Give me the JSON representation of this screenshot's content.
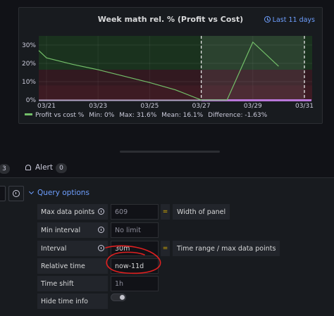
{
  "panel": {
    "title": "Week math rel. % (Profit vs Cost)",
    "time_range": "Last 11 days",
    "legend": {
      "series": "Profit vs cost %",
      "min": "Min: 0%",
      "max": "Max: 31.6%",
      "mean": "Mean: 16.1%",
      "difference": "Difference: -1.63%"
    }
  },
  "chart_data": {
    "type": "line",
    "y_ticks": [
      "30%",
      "20%",
      "10%",
      "0%"
    ],
    "x_ticks": [
      "03/21",
      "03/23",
      "03/25",
      "03/27",
      "03/29",
      "03/31"
    ],
    "ylim": [
      0,
      35
    ],
    "xlim": [
      "03/21",
      "03/31"
    ],
    "series": [
      {
        "name": "Profit vs cost %",
        "color": "#73bf69",
        "points": [
          [
            "03/20",
            27
          ],
          [
            "03/21",
            23
          ],
          [
            "03/22",
            19.5
          ],
          [
            "03/23",
            16.5
          ],
          [
            "03/24",
            13
          ],
          [
            "03/25",
            9.5
          ],
          [
            "03/26",
            5.5
          ],
          [
            "03/27",
            0
          ],
          [
            "03/28",
            0
          ],
          [
            "03/29",
            31.6
          ],
          [
            "03/30",
            18.4
          ]
        ]
      }
    ],
    "threshold_colors": [
      "#1b3b1f",
      "#3b1a22",
      "#4a1c26"
    ],
    "dashed_markers": [
      "03/27",
      "03/31"
    ],
    "bottom_band_color": "#b877d9",
    "grid": true
  },
  "tabs": {
    "left_count": "3",
    "alert_label": "Alert",
    "alert_count": "0"
  },
  "query_options": {
    "header": "Query options",
    "rows": [
      {
        "label": "Max data points",
        "value": "609",
        "note": "Width of panel"
      },
      {
        "label": "Min interval",
        "value": "No limit"
      },
      {
        "label": "Interval",
        "value": "30m",
        "note": "Time range / max data points"
      },
      {
        "label": "Relative time",
        "value": "now-11d"
      },
      {
        "label": "Time shift",
        "value": "1h"
      },
      {
        "label": "Hide time info"
      }
    ]
  }
}
